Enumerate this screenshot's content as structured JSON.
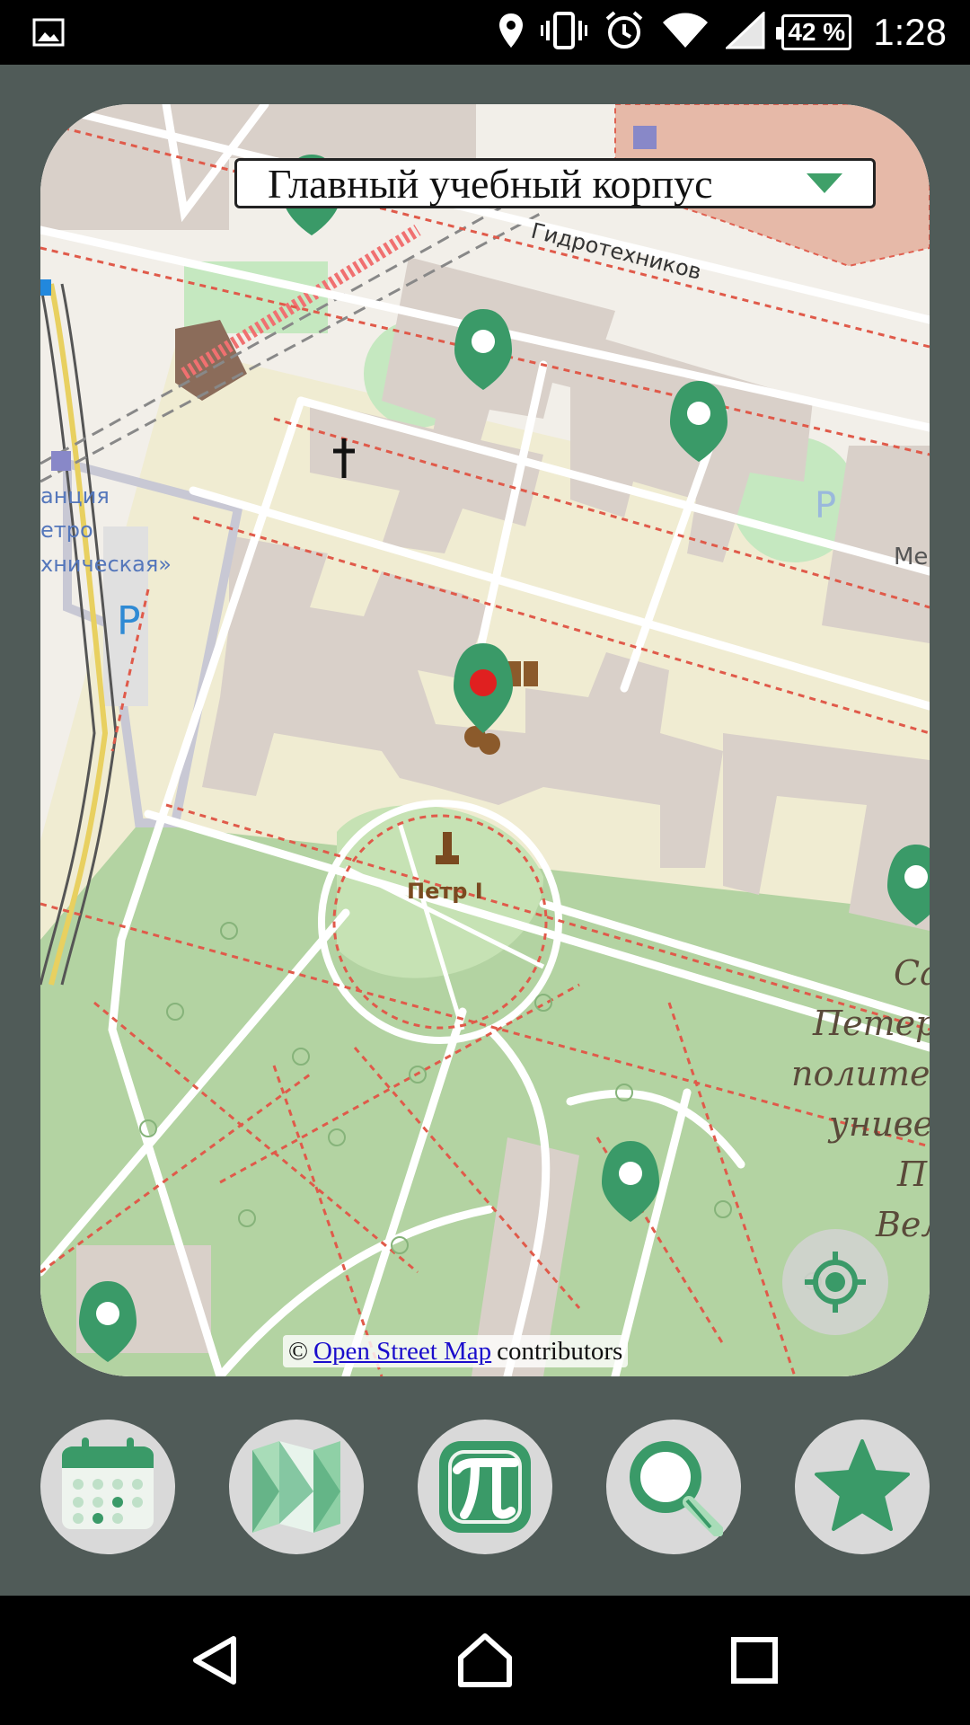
{
  "status_bar": {
    "battery_percent": "42 %",
    "time": "1:28",
    "icons": [
      "image-icon",
      "location-icon",
      "vibrate-icon",
      "alarm-icon",
      "wifi-icon",
      "signal-icon",
      "battery-icon"
    ]
  },
  "map": {
    "building_selector": {
      "selected": "Главный учебный корпус"
    },
    "labels": {
      "street": "Гидротехников",
      "monument": "Петр I",
      "station_line1": "анция",
      "station_line2": "етро",
      "station_line3": "хническая»",
      "edge_label": "Ме",
      "parking": "P",
      "university_line1": "Са",
      "university_line2": "Петер",
      "university_line3": "полите",
      "university_line4": "униве",
      "university_line5": "П",
      "university_line6": "Вел"
    },
    "attribution": {
      "prefix": "©",
      "link": "Open Street Map",
      "suffix": "contributors"
    },
    "colors": {
      "marker": "#3a9a68",
      "selected_dot": "#e02020",
      "park": "#aed1a0",
      "building": "#d9d0c9"
    }
  },
  "app_nav": {
    "items": [
      {
        "name": "schedule",
        "icon": "calendar-icon"
      },
      {
        "name": "map",
        "icon": "map-icon"
      },
      {
        "name": "teachers",
        "icon": "pi-icon"
      },
      {
        "name": "search",
        "icon": "search-icon"
      },
      {
        "name": "favorites",
        "icon": "star-icon"
      }
    ]
  },
  "system_nav": {
    "items": [
      "back",
      "home",
      "recents"
    ]
  }
}
